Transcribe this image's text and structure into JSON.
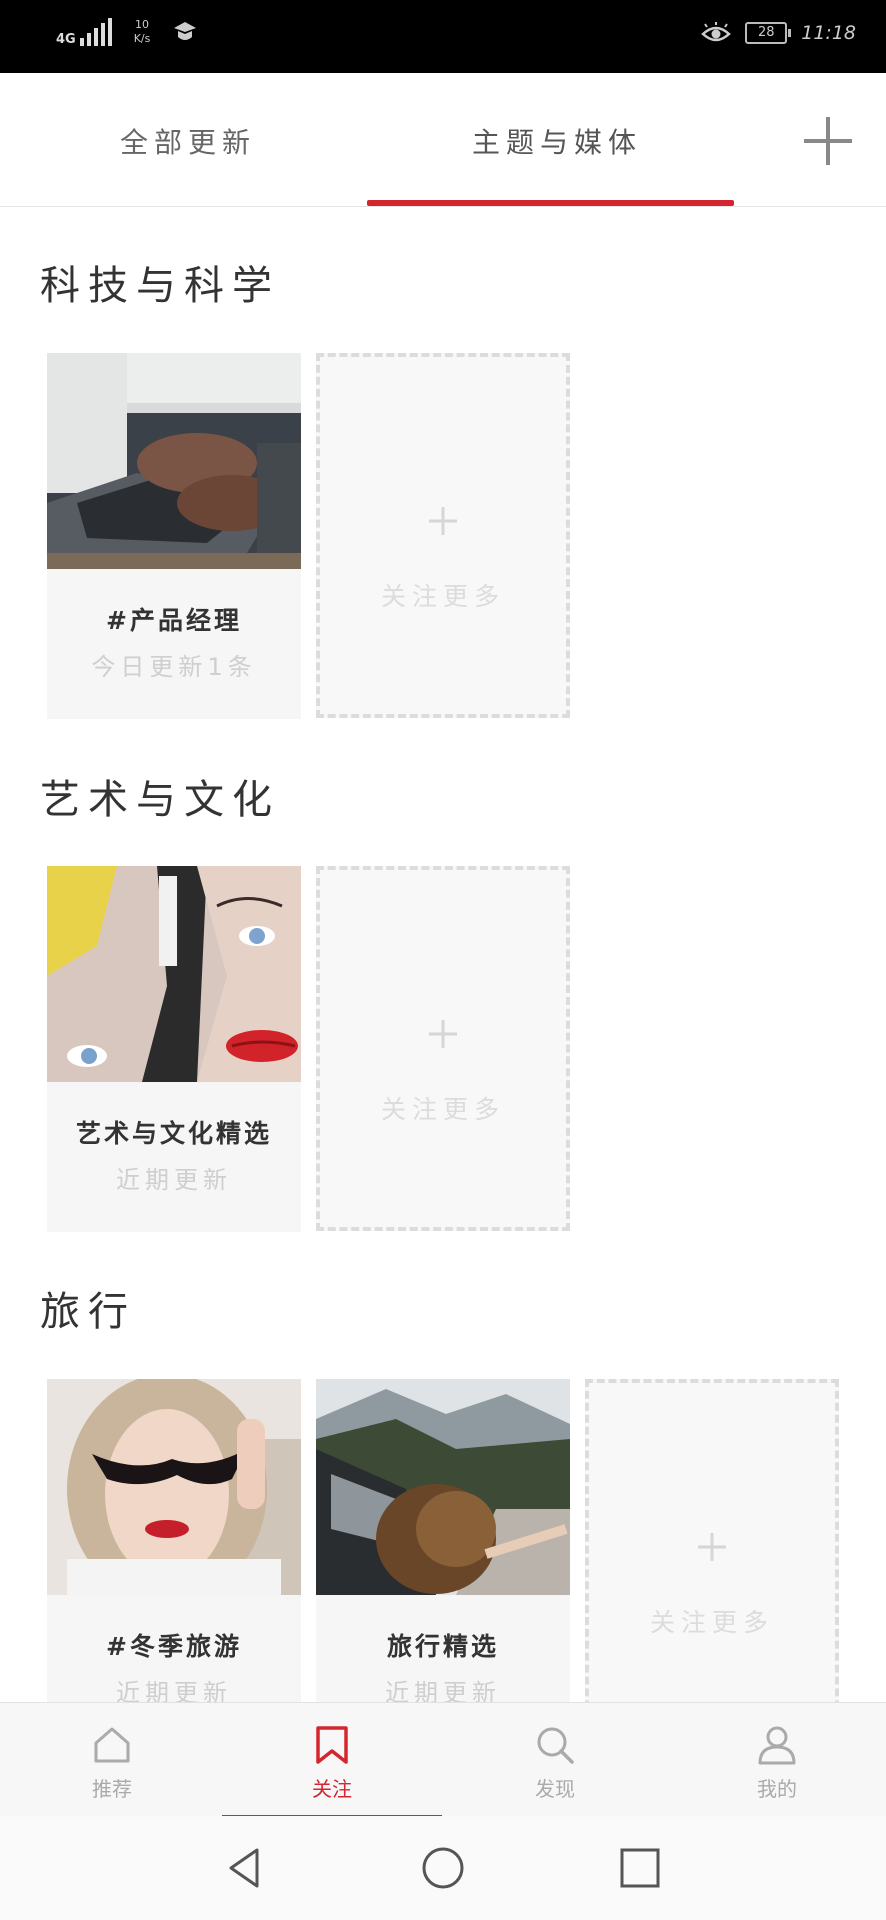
{
  "status_bar": {
    "network": "4G",
    "speed_value": "10",
    "speed_unit": "K/s",
    "battery": "28",
    "time": "11:18"
  },
  "top_tabs": {
    "items": [
      {
        "label": "全部更新",
        "active": false
      },
      {
        "label": "主题与媒体",
        "active": true
      }
    ],
    "add_icon": "plus-icon",
    "accent_color": "#d4262f"
  },
  "sections": [
    {
      "title": "科技与科学",
      "cards": [
        {
          "title": "#产品经理",
          "subtitle": "今日更新1条",
          "image": "laptop-typing-photo"
        }
      ],
      "follow_more": "关注更多"
    },
    {
      "title": "艺术与文化",
      "cards": [
        {
          "title": "艺术与文化精选",
          "subtitle": "近期更新",
          "image": "pop-art-mural-photo"
        }
      ],
      "follow_more": "关注更多"
    },
    {
      "title": "旅行",
      "cards": [
        {
          "title": "#冬季旅游",
          "subtitle": "近期更新",
          "image": "woman-sunglasses-photo"
        },
        {
          "title": "旅行精选",
          "subtitle": "近期更新",
          "image": "car-window-road-photo"
        }
      ],
      "follow_more": "关注更多"
    }
  ],
  "bottom_nav": {
    "items": [
      {
        "label": "推荐",
        "icon": "home-icon",
        "active": false
      },
      {
        "label": "关注",
        "icon": "bookmark-icon",
        "active": true
      },
      {
        "label": "发现",
        "icon": "search-icon",
        "active": false
      },
      {
        "label": "我的",
        "icon": "person-icon",
        "active": false
      }
    ]
  },
  "system_nav": {
    "icons": [
      "back-icon",
      "home-circle-icon",
      "recents-icon"
    ]
  }
}
